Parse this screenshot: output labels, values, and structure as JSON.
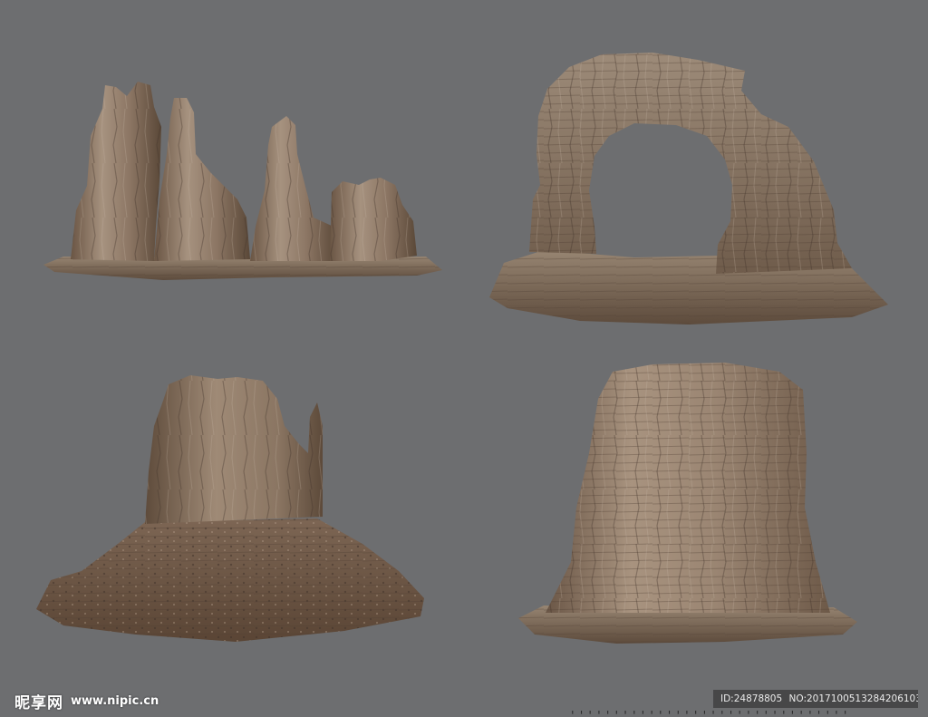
{
  "watermark": {
    "brand": "昵享网",
    "url": "www.nipic.cn"
  },
  "image_info": {
    "id_text": "ID:24878805",
    "no_text": "NO:20171005132842061030"
  },
  "colors": {
    "background": "#6d6e70",
    "rock_light": "#a38f7c",
    "rock_mid": "#8a7461",
    "rock_dark": "#5e4c3d",
    "rock_shadow": "#3f3229"
  }
}
